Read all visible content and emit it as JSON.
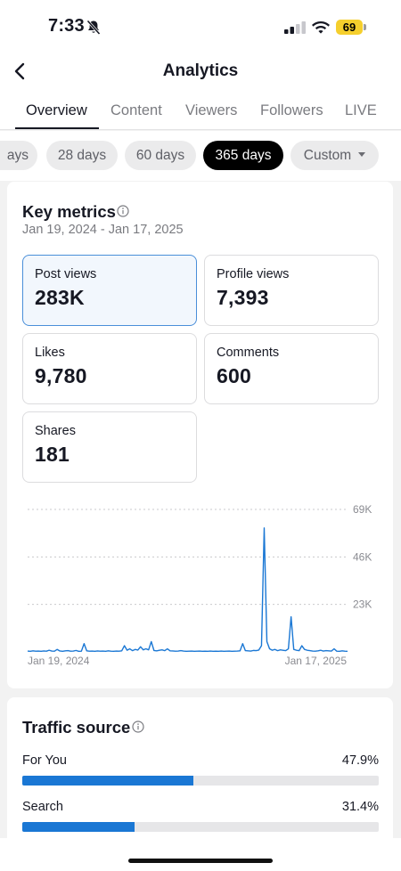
{
  "status_bar": {
    "time": "7:33",
    "battery": "69",
    "icons": [
      "bell-slash-icon",
      "signal-icon",
      "wifi-icon",
      "battery-icon"
    ],
    "battery_color": "#f5cf2d"
  },
  "header": {
    "title": "Analytics",
    "back_icon": "chevron-left-icon"
  },
  "tabs": [
    {
      "label": "Overview",
      "active": true
    },
    {
      "label": "Content",
      "active": false
    },
    {
      "label": "Viewers",
      "active": false
    },
    {
      "label": "Followers",
      "active": false
    },
    {
      "label": "LIVE",
      "active": false
    }
  ],
  "ranges": [
    {
      "label": "ays",
      "active": false
    },
    {
      "label": "28 days",
      "active": false
    },
    {
      "label": "60 days",
      "active": false
    },
    {
      "label": "365 days",
      "active": true
    },
    {
      "label": "Custom",
      "active": false
    }
  ],
  "key_metrics": {
    "title": "Key metrics",
    "date_range": "Jan 19, 2024 - Jan 17, 2025",
    "metrics": [
      {
        "label": "Post views",
        "value": "283K",
        "selected": true
      },
      {
        "label": "Profile views",
        "value": "7,393",
        "selected": false
      },
      {
        "label": "Likes",
        "value": "9,780",
        "selected": false
      },
      {
        "label": "Comments",
        "value": "600",
        "selected": false
      },
      {
        "label": "Shares",
        "value": "181",
        "selected": false
      }
    ]
  },
  "chart_data": {
    "type": "line",
    "title": "",
    "xlabel": "",
    "ylabel": "",
    "x_tick_labels": [
      "Jan 19, 2024",
      "Jan 17, 2025"
    ],
    "y_tick_labels": [
      "69K",
      "46K",
      "23K"
    ],
    "ylim": [
      0,
      69000
    ],
    "grid": true,
    "line_color": "#1a77d4",
    "series": [
      {
        "values": [
          400,
          300,
          500,
          350,
          400,
          300,
          450,
          350,
          800,
          400,
          350,
          1200,
          450,
          300,
          500,
          600,
          350,
          400,
          700,
          300,
          350,
          4000,
          500,
          350,
          400,
          300,
          450,
          350,
          400,
          300,
          500,
          350,
          300,
          400,
          350,
          500,
          3000,
          800,
          1500,
          600,
          1200,
          900,
          2500,
          1000,
          1500,
          1000,
          5000,
          700,
          500,
          800,
          1000,
          600,
          1500,
          500,
          450,
          350,
          400,
          600,
          400,
          300,
          350,
          400,
          300,
          350,
          400,
          300,
          350,
          300,
          400,
          300,
          350,
          300,
          400,
          300,
          350,
          400,
          300,
          350,
          400,
          500,
          4000,
          600,
          500,
          400,
          700,
          600,
          900,
          3000,
          60000,
          5000,
          1500,
          800,
          1200,
          600,
          1000,
          800,
          600,
          1500,
          17000,
          1200,
          800,
          600,
          3000,
          1200,
          800,
          600,
          400,
          350,
          500,
          800,
          400,
          600,
          500,
          400,
          1500,
          350,
          300,
          500,
          350,
          300
        ]
      }
    ]
  },
  "traffic_source": {
    "title": "Traffic source",
    "items": [
      {
        "label": "For You",
        "percent_label": "47.9%",
        "percent": 47.9
      },
      {
        "label": "Search",
        "percent_label": "31.4%",
        "percent": 31.4
      }
    ]
  }
}
